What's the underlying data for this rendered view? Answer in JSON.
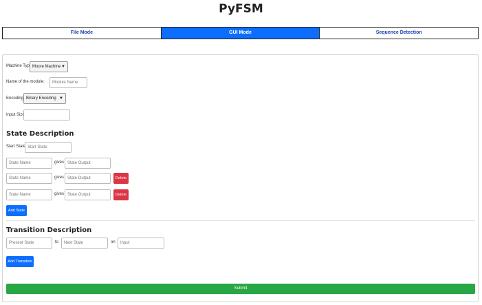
{
  "app": {
    "title": "PyFSM"
  },
  "modes": [
    "File Mode",
    "GUI Mode",
    "Sequence Detection"
  ],
  "form": {
    "machine_type_label": "Machine Type:",
    "machine_type_value": "Moore Machine",
    "module_name_label": "Name of the module:",
    "module_name_placeholder": "Module Name",
    "encoding_label": "Encoding:",
    "encoding_value": "Binary Encoding",
    "input_size_label": "Input Size:",
    "input_size_value": ""
  },
  "state_section": {
    "heading": "State Description",
    "start_state_label": "Start State:",
    "start_state_placeholder": "Start State",
    "gives_label": "gives",
    "rows": [
      {
        "name_placeholder": "State Name",
        "output_placeholder": "State Output",
        "delete": ""
      },
      {
        "name_placeholder": "State Name",
        "output_placeholder": "State Output",
        "delete": "Delete"
      },
      {
        "name_placeholder": "State Name",
        "output_placeholder": "State Output",
        "delete": "Delete"
      }
    ],
    "add_label": "Add State"
  },
  "transition_section": {
    "heading": "Transition Description",
    "present_placeholder": "Present State",
    "to_label": "to",
    "next_placeholder": "Next State",
    "on_label": "on",
    "input_placeholder": "Input",
    "add_label": "Add Transition"
  },
  "submit_label": "Submit",
  "colors": {
    "primary": "#0d6efd",
    "danger": "#dc3545",
    "success": "#28a745"
  }
}
